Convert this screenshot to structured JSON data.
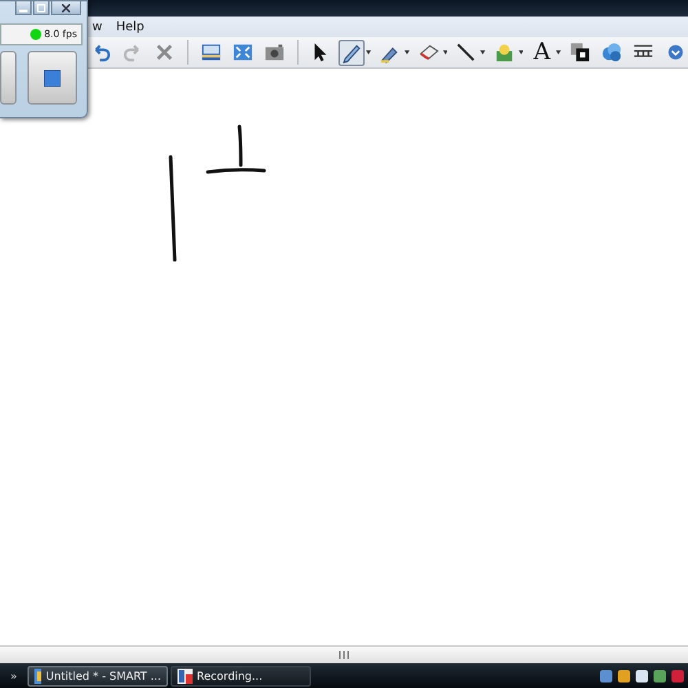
{
  "menu": {
    "items": [
      "w",
      "Help"
    ]
  },
  "toolbar": [
    {
      "kind": "undo",
      "disabled": false
    },
    {
      "kind": "redo",
      "disabled": true
    },
    {
      "kind": "delete",
      "disabled": false
    },
    {
      "kind": "sep"
    },
    {
      "kind": "shade"
    },
    {
      "kind": "fullscreen"
    },
    {
      "kind": "capture"
    },
    {
      "kind": "sep"
    },
    {
      "kind": "select",
      "selected": false
    },
    {
      "kind": "pen",
      "selected": true,
      "caret": true
    },
    {
      "kind": "highlighter",
      "selected": false,
      "caret": true
    },
    {
      "kind": "eraser",
      "selected": false,
      "caret": true
    },
    {
      "kind": "line",
      "selected": false,
      "caret": true
    },
    {
      "kind": "fill",
      "selected": false,
      "caret": true
    },
    {
      "kind": "text",
      "label": "A",
      "selected": false,
      "caret": true
    },
    {
      "kind": "layer"
    },
    {
      "kind": "globe"
    },
    {
      "kind": "table"
    },
    {
      "kind": "more"
    }
  ],
  "recorder": {
    "fps": "8.0 fps",
    "recording": true
  },
  "taskbar": {
    "overflow": "»",
    "tasks": [
      {
        "label": "Untitled * - SMART ...",
        "kind": "notebook",
        "selected": true
      },
      {
        "label": "Recording...",
        "kind": "recorder",
        "selected": false
      }
    ]
  }
}
